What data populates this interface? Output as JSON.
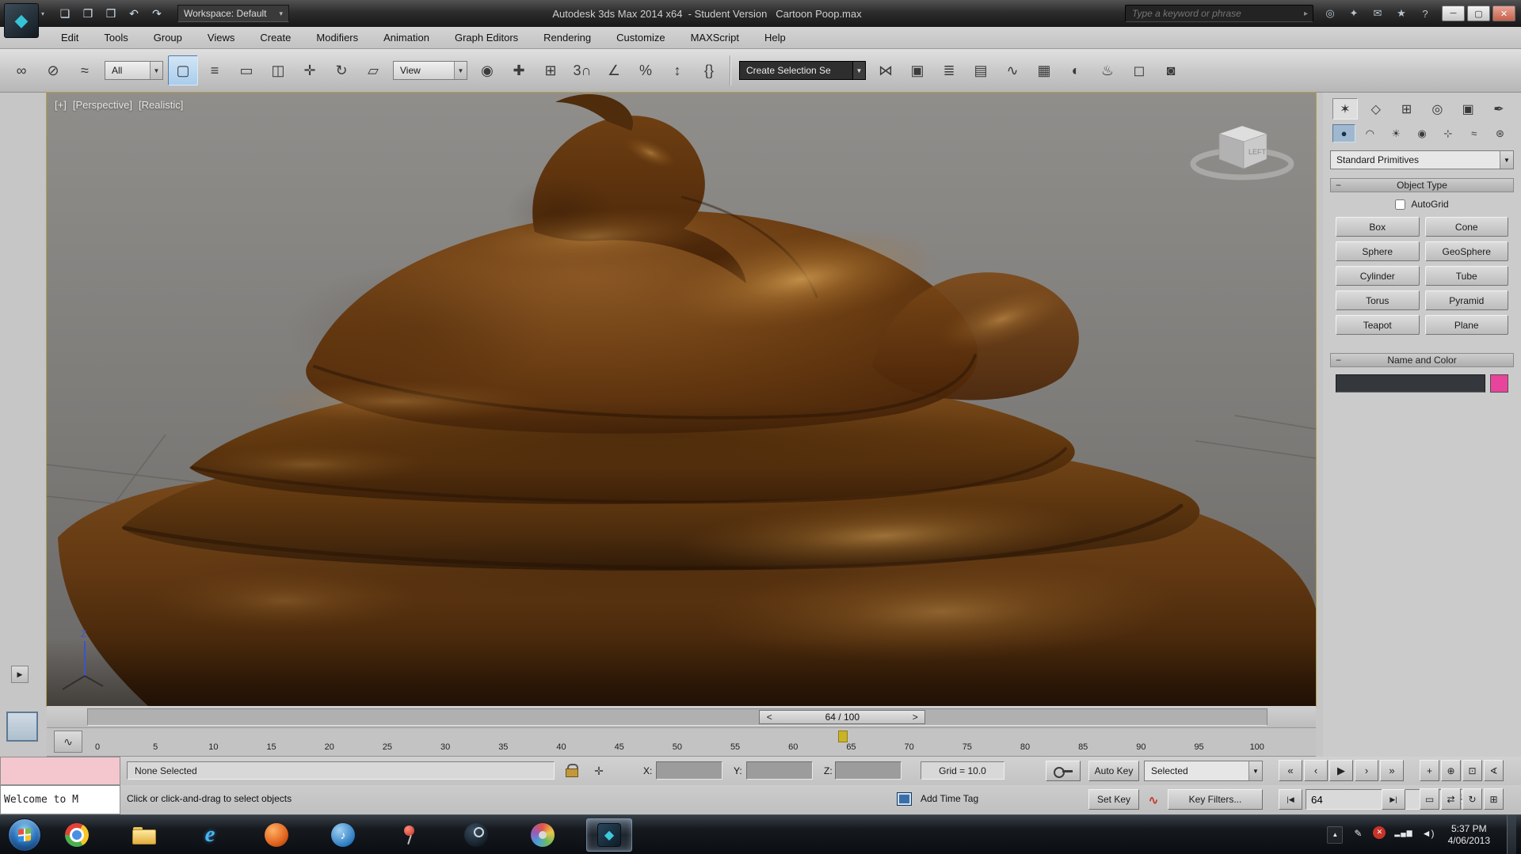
{
  "colors": {
    "swatch_pink": "#e8449c",
    "timeline_marker": "#c9b427",
    "select_highlight": "#a9cdec"
  },
  "title_bar": {
    "app_menu_glyph": "◆",
    "qat": [
      {
        "name": "new-scene-icon",
        "glyph": "❏"
      },
      {
        "name": "open-file-icon",
        "glyph": "❐"
      },
      {
        "name": "save-file-icon",
        "glyph": "❒"
      },
      {
        "name": "undo-icon",
        "glyph": "↶"
      },
      {
        "name": "redo-icon",
        "glyph": "↷"
      }
    ],
    "workspace_label": "Workspace: Default",
    "title": "Autodesk 3ds Max 2014 x64  - Student Version   Cartoon Poop.max",
    "search_placeholder": "Type a keyword or phrase",
    "right_icons": [
      {
        "name": "infocenter-search-icon",
        "glyph": "◎"
      },
      {
        "name": "sign-in-icon",
        "glyph": "✦"
      },
      {
        "name": "communication-center-icon",
        "glyph": "✉"
      },
      {
        "name": "favorites-icon",
        "glyph": "★"
      },
      {
        "name": "help-icon",
        "glyph": "?"
      }
    ],
    "window_buttons": [
      {
        "name": "minimize-button",
        "glyph": "─"
      },
      {
        "name": "maximize-button",
        "glyph": "▢"
      },
      {
        "name": "close-button",
        "glyph": "✕",
        "cls": "close"
      }
    ]
  },
  "menu_bar": {
    "items": [
      {
        "name": "menu-edit",
        "label": "Edit"
      },
      {
        "name": "menu-tools",
        "label": "Tools"
      },
      {
        "name": "menu-group",
        "label": "Group"
      },
      {
        "name": "menu-views",
        "label": "Views"
      },
      {
        "name": "menu-create",
        "label": "Create"
      },
      {
        "name": "menu-modifiers",
        "label": "Modifiers"
      },
      {
        "name": "menu-animation",
        "label": "Animation"
      },
      {
        "name": "menu-graph-editors",
        "label": "Graph Editors"
      },
      {
        "name": "menu-rendering",
        "label": "Rendering"
      },
      {
        "name": "menu-customize",
        "label": "Customize"
      },
      {
        "name": "menu-maxscript",
        "label": "MAXScript"
      },
      {
        "name": "menu-help",
        "label": "Help"
      }
    ]
  },
  "main_toolbar": {
    "group1": [
      {
        "name": "select-and-link-icon",
        "glyph": "∞"
      },
      {
        "name": "unlink-selection-icon",
        "glyph": "⊘"
      },
      {
        "name": "bind-to-space-warp-icon",
        "glyph": "≈"
      }
    ],
    "selection_filter_value": "All",
    "group2": [
      {
        "name": "select-object-icon",
        "glyph": "▢",
        "cls": "active"
      },
      {
        "name": "select-by-name-icon",
        "glyph": "≡"
      },
      {
        "name": "rectangular-selection-region-icon",
        "glyph": "▭"
      },
      {
        "name": "window-crossing-icon",
        "glyph": "◫"
      },
      {
        "name": "select-and-move-icon",
        "glyph": "✛"
      },
      {
        "name": "select-and-rotate-icon",
        "glyph": "↻"
      },
      {
        "name": "select-and-scale-icon",
        "glyph": "▱"
      }
    ],
    "ref_coord_value": "View",
    "group3": [
      {
        "name": "use-pivot-point-icon",
        "glyph": "◉"
      },
      {
        "name": "select-and-manipulate-icon",
        "glyph": "✚"
      },
      {
        "name": "keyboard-override-icon",
        "glyph": "⊞"
      },
      {
        "name": "snap-toggle-3d-icon",
        "glyph": "3∩"
      },
      {
        "name": "angle-snap-icon",
        "glyph": "∠"
      },
      {
        "name": "percent-snap-icon",
        "glyph": "%"
      },
      {
        "name": "spinner-snap-icon",
        "glyph": "↕"
      },
      {
        "name": "edit-named-selection-sets-icon",
        "glyph": "{}"
      }
    ],
    "named_sets_value": "Create Selection Se",
    "group4": [
      {
        "name": "mirror-icon",
        "glyph": "⋈"
      },
      {
        "name": "align-icon",
        "glyph": "▣"
      },
      {
        "name": "layer-manager-icon",
        "glyph": "≣"
      },
      {
        "name": "ribbon-toggle-icon",
        "glyph": "▤"
      },
      {
        "name": "curve-editor-icon",
        "glyph": "∿"
      },
      {
        "name": "schematic-view-icon",
        "glyph": "▦"
      },
      {
        "name": "material-editor-icon",
        "glyph": "◐"
      },
      {
        "name": "render-setup-icon",
        "glyph": "♨"
      },
      {
        "name": "rendered-frame-window-icon",
        "glyph": "◻"
      },
      {
        "name": "render-production-icon",
        "glyph": "◙"
      }
    ]
  },
  "viewport": {
    "labels": [
      "[+]",
      "[Perspective]",
      "[Realistic]"
    ],
    "axis_label": "Z",
    "viewcube_face": "LEFT"
  },
  "command_panel": {
    "tabs": [
      {
        "name": "create-tab",
        "glyph": "✶",
        "cls": "active"
      },
      {
        "name": "modify-tab",
        "glyph": "◇"
      },
      {
        "name": "hierarchy-tab",
        "glyph": "⊞"
      },
      {
        "name": "motion-tab",
        "glyph": "◎"
      },
      {
        "name": "display-tab",
        "glyph": "▣"
      },
      {
        "name": "utilities-tab",
        "glyph": "✒"
      }
    ],
    "categories": [
      {
        "name": "geometry-category-icon",
        "glyph": "●",
        "cls": "active"
      },
      {
        "name": "shapes-category-icon",
        "glyph": "◠"
      },
      {
        "name": "lights-category-icon",
        "glyph": "☀"
      },
      {
        "name": "cameras-category-icon",
        "glyph": "◉"
      },
      {
        "name": "helpers-category-icon",
        "glyph": "⊹"
      },
      {
        "name": "space-warps-category-icon",
        "glyph": "≈"
      },
      {
        "name": "systems-category-icon",
        "glyph": "⊛"
      }
    ],
    "subcategory_value": "Standard Primitives",
    "object_type": {
      "title": "Object Type",
      "autogrid_label": "AutoGrid",
      "buttons": [
        {
          "name": "box-button",
          "label": "Box"
        },
        {
          "name": "cone-button",
          "label": "Cone"
        },
        {
          "name": "sphere-button",
          "label": "Sphere"
        },
        {
          "name": "geosphere-button",
          "label": "GeoSphere"
        },
        {
          "name": "cylinder-button",
          "label": "Cylinder"
        },
        {
          "name": "tube-button",
          "label": "Tube"
        },
        {
          "name": "torus-button",
          "label": "Torus"
        },
        {
          "name": "pyramid-button",
          "label": "Pyramid"
        },
        {
          "name": "teapot-button",
          "label": "Teapot"
        },
        {
          "name": "plane-button",
          "label": "Plane"
        }
      ]
    },
    "name_color": {
      "title": "Name and Color",
      "name_value": "",
      "swatch_color": "#e8449c"
    }
  },
  "timeline": {
    "frame_display": "64 / 100",
    "prev_glyph": "<",
    "next_glyph": ">",
    "current_frame": 64,
    "total_frames": 100,
    "mini_curve_glyph": "∿",
    "ticks": [
      "0",
      "5",
      "10",
      "15",
      "20",
      "25",
      "30",
      "35",
      "40",
      "45",
      "50",
      "55",
      "60",
      "65",
      "70",
      "75",
      "80",
      "85",
      "90",
      "95",
      "100"
    ]
  },
  "status_bar": {
    "listener_text": "Welcome to M",
    "selection_status": "None Selected",
    "prompt": "Click or click-and-drag to select objects",
    "x_label": "X:",
    "y_label": "Y:",
    "z_label": "Z:",
    "grid_text": "Grid = 10.0",
    "time_tag_label": "Add Time Tag",
    "auto_key_label": "Auto Key",
    "set_key_label": "Set Key",
    "key_mode_value": "Selected",
    "key_filters_label": "Key Filters...",
    "frame_value": "64",
    "playback": [
      {
        "name": "go-to-start-button",
        "glyph": "«"
      },
      {
        "name": "previous-frame-button",
        "glyph": "‹"
      },
      {
        "name": "play-animation-button",
        "glyph": "▶"
      },
      {
        "name": "next-frame-button",
        "glyph": "›"
      },
      {
        "name": "go-to-end-button",
        "glyph": "»"
      }
    ],
    "prev_key_glyph": "|◀",
    "next_key_glyph": "▶|",
    "nav_row1": [
      {
        "name": "zoom-button",
        "glyph": "+"
      },
      {
        "name": "zoom-all-button",
        "glyph": "⊕"
      },
      {
        "name": "zoom-extents-button",
        "glyph": "⊡"
      },
      {
        "name": "fov-button",
        "glyph": "∢"
      }
    ],
    "nav_row2": [
      {
        "name": "zoom-region-button",
        "glyph": "▭"
      },
      {
        "name": "pan-button",
        "glyph": "⇄"
      },
      {
        "name": "orbit-button",
        "glyph": "↻"
      },
      {
        "name": "maximize-viewport-button",
        "glyph": "⊞"
      }
    ]
  },
  "taskbar": {
    "apps": [
      {
        "name": "taskbar-chrome-icon",
        "kind": "chrome"
      },
      {
        "name": "taskbar-explorer-icon",
        "kind": "explorer"
      },
      {
        "name": "taskbar-ie-icon",
        "kind": "ie",
        "glyph": "e"
      },
      {
        "name": "taskbar-media-app-icon",
        "kind": "media"
      },
      {
        "name": "taskbar-itunes-icon",
        "kind": "itunes",
        "glyph": "♪"
      },
      {
        "name": "taskbar-pin-icon",
        "kind": "pin"
      },
      {
        "name": "taskbar-steam-icon",
        "kind": "steam"
      },
      {
        "name": "taskbar-paint-icon",
        "kind": "paint"
      },
      {
        "name": "taskbar-3dsmax-icon",
        "kind": "max",
        "cls": "active",
        "glyph": "◆"
      }
    ],
    "tray_icons": [
      {
        "name": "tray-show-hidden-icon",
        "glyph": "▲",
        "cls": "btnup"
      },
      {
        "name": "tray-pencil-icon",
        "glyph": "✎"
      },
      {
        "name": "tray-error-icon",
        "glyph": "✕",
        "cls": "redx"
      },
      {
        "name": "tray-network-icon",
        "glyph": "▂▄▆",
        "cls": "bars"
      },
      {
        "name": "tray-volume-icon",
        "glyph": "◄)"
      }
    ],
    "tray_time": "5:37 PM",
    "tray_date": "4/06/2013"
  }
}
